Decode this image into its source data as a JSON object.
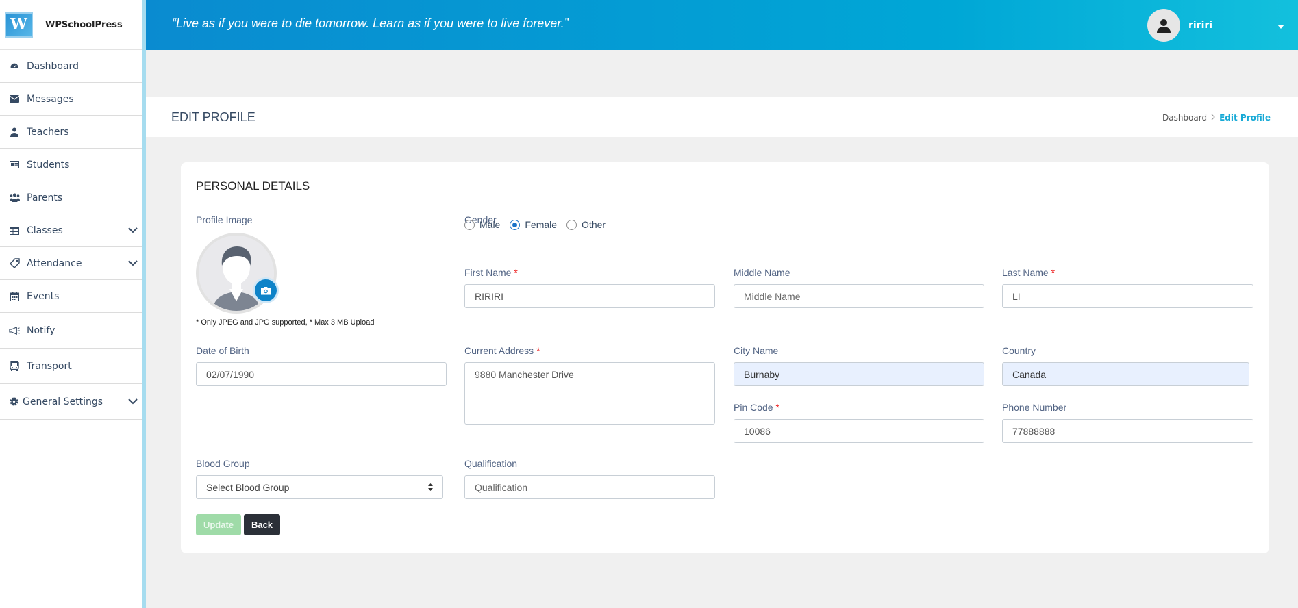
{
  "brand": {
    "name": "WPSchoolPress",
    "logo_letter": "W"
  },
  "header": {
    "quote": "“Live as if you were to die tomorrow. Learn as if you were to live forever.”",
    "username": "ririri"
  },
  "sidebar": {
    "items": [
      {
        "label": "Dashboard",
        "icon": "dashboard-icon"
      },
      {
        "label": "Messages",
        "icon": "envelope-icon"
      },
      {
        "label": "Teachers",
        "icon": "teacher-icon"
      },
      {
        "label": "Students",
        "icon": "id-card-icon"
      },
      {
        "label": "Parents",
        "icon": "users-icon"
      },
      {
        "label": "Classes",
        "icon": "table-icon",
        "expandable": true
      },
      {
        "label": "Attendance",
        "icon": "tag-icon",
        "expandable": true
      },
      {
        "label": "Events",
        "icon": "calendar-icon"
      },
      {
        "label": "Notify",
        "icon": "megaphone-icon"
      },
      {
        "label": "Transport",
        "icon": "bus-icon"
      },
      {
        "label": "General Settings",
        "icon": "gear-icon",
        "expandable": true
      }
    ]
  },
  "page": {
    "title": "EDIT PROFILE",
    "breadcrumb": {
      "home": "Dashboard",
      "current": "Edit Profile"
    }
  },
  "form": {
    "section_title": "PERSONAL DETAILS",
    "profile_image_label": "Profile Image",
    "upload_hint": "* Only JPEG and JPG supported, * Max 3 MB Upload",
    "gender": {
      "label": "Gender",
      "options": [
        "Male",
        "Female",
        "Other"
      ],
      "selected": "Female"
    },
    "first_name": {
      "label": "First Name",
      "value": "RIRIRI",
      "required": "*"
    },
    "middle_name": {
      "label": "Middle Name",
      "placeholder": "Middle Name"
    },
    "last_name": {
      "label": "Last Name",
      "value": "LI",
      "required": "*"
    },
    "dob": {
      "label": "Date of Birth",
      "value": "02/07/1990"
    },
    "address": {
      "label": "Current Address",
      "value": "9880 Manchester Drive",
      "required": "*"
    },
    "city": {
      "label": "City Name",
      "value": "Burnaby"
    },
    "country": {
      "label": "Country",
      "value": "Canada"
    },
    "pin": {
      "label": "Pin Code",
      "value": "10086",
      "required": "*"
    },
    "phone": {
      "label": "Phone Number",
      "value": "77888888"
    },
    "blood": {
      "label": "Blood Group",
      "value": "Select Blood Group"
    },
    "qualification": {
      "label": "Qualification",
      "placeholder": "Qualification"
    },
    "update_label": "Update",
    "back_label": "Back"
  },
  "colors": {
    "accent": "#00a7d6",
    "update_button": "#9fdba8",
    "back_button": "#2b3038",
    "autofill": "#e8f0fe"
  }
}
